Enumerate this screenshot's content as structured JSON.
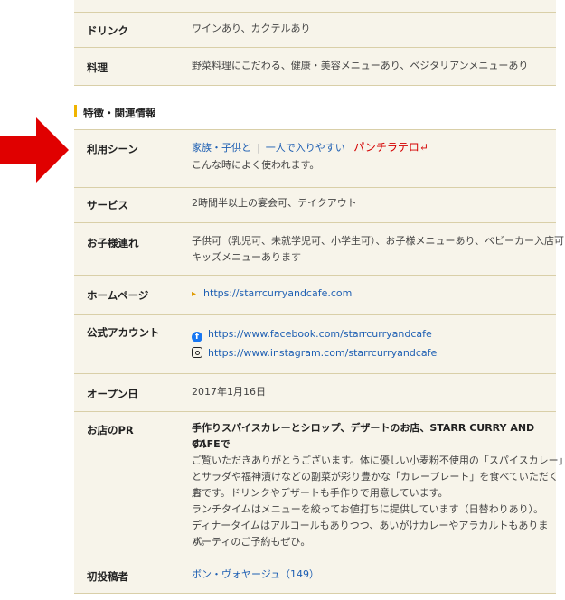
{
  "colors": {
    "accent_bar": "#f0b400",
    "arrow": "#e00000",
    "link": "#1e5fb3",
    "row_band": "#f7f4ea",
    "divider": "#d9cfa8"
  },
  "rows_top": [
    {
      "label": "ドリンク",
      "value": "ワインあり、カクテルあり"
    },
    {
      "label": "料理",
      "value": "野菜料理にこだわる、健康・美容メニューあり、ベジタリアンメニューあり"
    }
  ],
  "section": {
    "title": "特徴・関連情報"
  },
  "usage": {
    "label": "利用シーン",
    "links": [
      "家族・子供と",
      "一人で入りやすい"
    ],
    "separator": "|",
    "annotation": "パンチラテロ↵",
    "sub": "こんな時によく使われます。"
  },
  "service": {
    "label": "サービス",
    "value": "2時間半以上の宴会可、テイクアウト"
  },
  "kids": {
    "label": "お子様連れ",
    "line1": "子供可（乳児可、未就学児可、小学生可）、お子様メニューあり、ベビーカー入店可",
    "line2": "キッズメニューあります"
  },
  "homepage": {
    "label": "ホームページ",
    "bullet": "▸",
    "url": "https://starrcurryandcafe.com"
  },
  "social": {
    "label": "公式アカウント",
    "facebook_icon": "facebook-icon",
    "facebook": "https://www.facebook.com/starrcurryandcafe",
    "instagram_icon": "instagram-icon",
    "instagram": "https://www.instagram.com/starrcurryandcafe"
  },
  "open_date": {
    "label": "オープン日",
    "value": "2017年1月16日"
  },
  "pr": {
    "label": "お店のPR",
    "headline_1": "手作りスパイスカレーとシロップ、デザートのお店、STARR CURRY AND CAFEで",
    "headline_2": "す！",
    "lines": [
      "ご覧いただきありがとうございます。体に優しい小麦粉不使用の「スパイスカレー」",
      "とサラダや福神漬けなどの副菜が彩り豊かな「カレープレート」を食べていただくお",
      "店です。ドリンクやデザートも手作りで用意しています。",
      "ランチタイムはメニューを絞ってお値打ちに提供しています（日替わりあり）。",
      "ディナータイムはアルコールもありつつ、あいがけカレーやアラカルトもあります。",
      "パーティのご予約もぜひ。"
    ]
  },
  "first_poster": {
    "label": "初投稿者",
    "value": "ボン・ヴォヤージュ（149）"
  }
}
